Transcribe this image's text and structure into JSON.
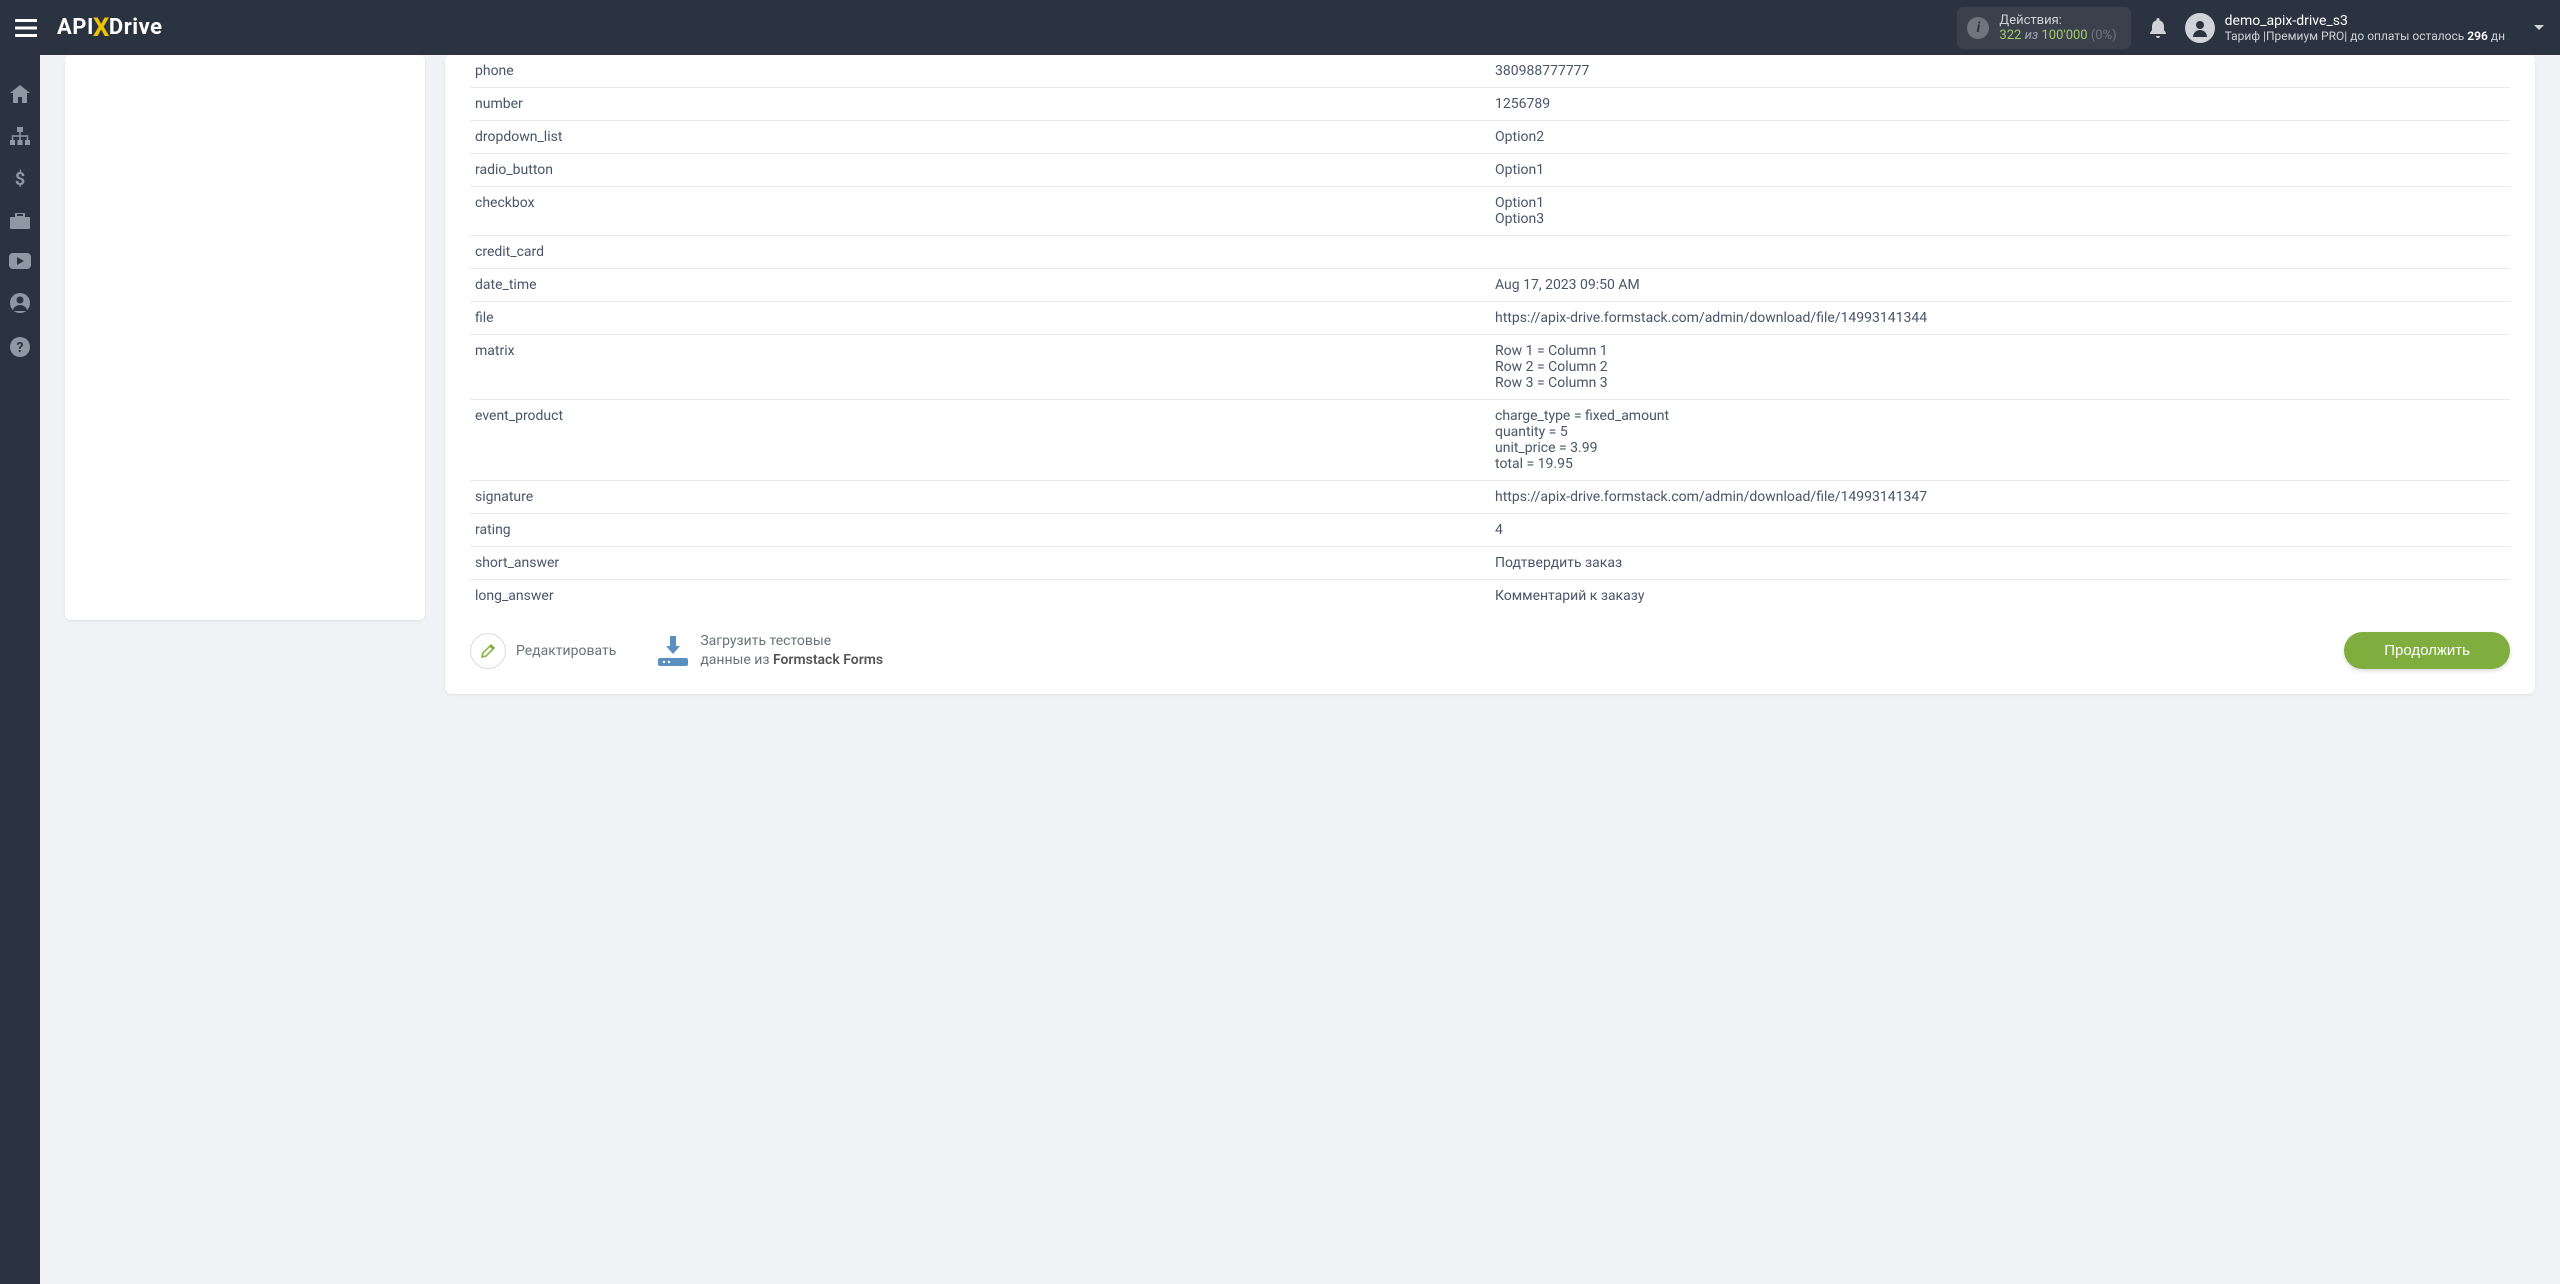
{
  "header": {
    "logo": {
      "part1": "API",
      "x": "X",
      "part2": "Drive"
    },
    "actions": {
      "label": "Действия:",
      "used": "322",
      "of": "из",
      "total": "100'000",
      "pct": "(0%)"
    },
    "user": {
      "name": "demo_apix-drive_s3",
      "tariff_prefix": "Тариф |Премиум PRO| до оплаты осталось ",
      "days": "296",
      "tariff_suffix": " дн"
    }
  },
  "table": {
    "rows": [
      {
        "key": "phone",
        "val": "380988777777"
      },
      {
        "key": "number",
        "val": "1256789"
      },
      {
        "key": "dropdown_list",
        "val": "Option2"
      },
      {
        "key": "radio_button",
        "val": "Option1"
      },
      {
        "key": "checkbox",
        "val": "Option1\nOption3"
      },
      {
        "key": "credit_card",
        "val": ""
      },
      {
        "key": "date_time",
        "val": "Aug 17, 2023 09:50 AM"
      },
      {
        "key": "file",
        "val": "https://apix-drive.formstack.com/admin/download/file/14993141344"
      },
      {
        "key": "matrix",
        "val": "Row 1 = Column 1\nRow 2 = Column 2\nRow 3 = Column 3"
      },
      {
        "key": "event_product",
        "val": "charge_type = fixed_amount\nquantity = 5\nunit_price = 3.99\ntotal = 19.95"
      },
      {
        "key": "signature",
        "val": "https://apix-drive.formstack.com/admin/download/file/14993141347"
      },
      {
        "key": "rating",
        "val": "4"
      },
      {
        "key": "short_answer",
        "val": "Подтвердить заказ"
      },
      {
        "key": "long_answer",
        "val": "Комментарий к заказу"
      }
    ]
  },
  "footer": {
    "edit": "Редактировать",
    "load_line1": "Загрузить тестовые",
    "load_line2_prefix": "данные из ",
    "load_line2_strong": "Formstack Forms",
    "continue": "Продолжить"
  }
}
